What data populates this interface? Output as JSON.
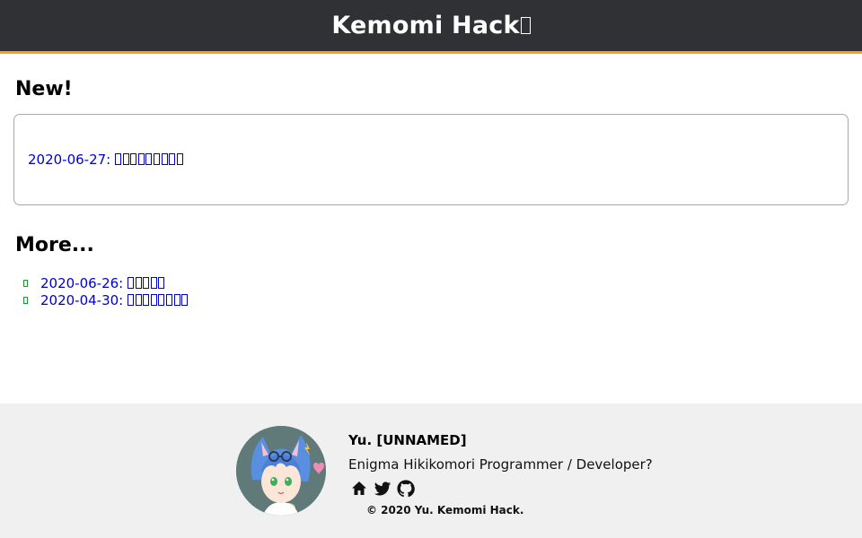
{
  "header": {
    "title": "Kemomi Hack"
  },
  "new_section": {
    "heading": "New!",
    "items": [
      {
        "date_prefix": "2020-06-27: ",
        "title_glyphs": 9
      }
    ]
  },
  "more_section": {
    "heading": "More...",
    "items": [
      {
        "date_prefix": "2020-06-26: ",
        "title_glyphs": 5
      },
      {
        "date_prefix": "2020-04-30: ",
        "title_glyphs": 8
      }
    ]
  },
  "footer": {
    "author_name": "Yu. [UNNAMED]",
    "bio": "Enigma Hikikomori Programmer / Developer?",
    "social_icons": [
      "home-icon",
      "twitter-icon",
      "github-icon"
    ],
    "copyright": "© 2020 Yu. Kemomi Hack."
  },
  "colors": {
    "header_bg": "#303134",
    "header_accent": "#f5a31a",
    "link": "#0000cc",
    "bullet": "#1a9a2e",
    "footer_bg": "#f0f0f0"
  }
}
